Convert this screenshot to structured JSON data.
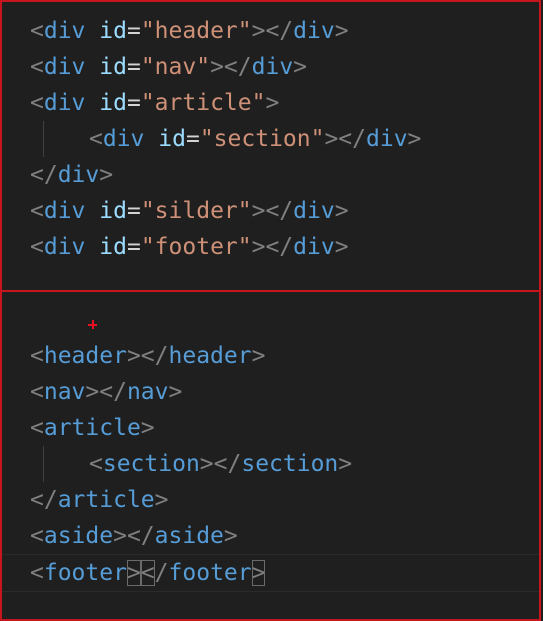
{
  "top_code": {
    "lines": [
      {
        "indent": 0,
        "tokens": [
          [
            "<",
            "tag-delim"
          ],
          [
            "div",
            "tag-name"
          ],
          [
            " ",
            ""
          ],
          [
            "id",
            "attr-name"
          ],
          [
            "=",
            "attr-eq"
          ],
          [
            "\"header\"",
            "attr-val"
          ],
          [
            "></",
            "tag-delim"
          ],
          [
            "div",
            "tag-name"
          ],
          [
            ">",
            "tag-delim"
          ]
        ]
      },
      {
        "indent": 0,
        "tokens": [
          [
            "<",
            "tag-delim"
          ],
          [
            "div",
            "tag-name"
          ],
          [
            " ",
            ""
          ],
          [
            "id",
            "attr-name"
          ],
          [
            "=",
            "attr-eq"
          ],
          [
            "\"nav\"",
            "attr-val"
          ],
          [
            "></",
            "tag-delim"
          ],
          [
            "div",
            "tag-name"
          ],
          [
            ">",
            "tag-delim"
          ]
        ]
      },
      {
        "indent": 0,
        "tokens": [
          [
            "<",
            "tag-delim"
          ],
          [
            "div",
            "tag-name"
          ],
          [
            " ",
            ""
          ],
          [
            "id",
            "attr-name"
          ],
          [
            "=",
            "attr-eq"
          ],
          [
            "\"article\"",
            "attr-val"
          ],
          [
            ">",
            "tag-delim"
          ]
        ]
      },
      {
        "indent": 1,
        "tokens": [
          [
            "<",
            "tag-delim"
          ],
          [
            "div",
            "tag-name"
          ],
          [
            " ",
            ""
          ],
          [
            "id",
            "attr-name"
          ],
          [
            "=",
            "attr-eq"
          ],
          [
            "\"section\"",
            "attr-val"
          ],
          [
            "></",
            "tag-delim"
          ],
          [
            "div",
            "tag-name"
          ],
          [
            ">",
            "tag-delim"
          ]
        ]
      },
      {
        "indent": 0,
        "tokens": [
          [
            "</",
            "tag-delim"
          ],
          [
            "div",
            "tag-name"
          ],
          [
            ">",
            "tag-delim"
          ]
        ]
      },
      {
        "indent": 0,
        "tokens": [
          [
            "<",
            "tag-delim"
          ],
          [
            "div",
            "tag-name"
          ],
          [
            " ",
            ""
          ],
          [
            "id",
            "attr-name"
          ],
          [
            "=",
            "attr-eq"
          ],
          [
            "\"silder\"",
            "attr-val"
          ],
          [
            "></",
            "tag-delim"
          ],
          [
            "div",
            "tag-name"
          ],
          [
            ">",
            "tag-delim"
          ]
        ]
      },
      {
        "indent": 0,
        "tokens": [
          [
            "<",
            "tag-delim"
          ],
          [
            "div",
            "tag-name"
          ],
          [
            " ",
            ""
          ],
          [
            "id",
            "attr-name"
          ],
          [
            "=",
            "attr-eq"
          ],
          [
            "\"footer\"",
            "attr-val"
          ],
          [
            "></",
            "tag-delim"
          ],
          [
            "div",
            "tag-name"
          ],
          [
            ">",
            "tag-delim"
          ]
        ]
      }
    ]
  },
  "bottom_code": {
    "lines": [
      {
        "indent": 0,
        "tokens": [
          [
            "<",
            "tag-delim"
          ],
          [
            "header",
            "tag-name"
          ],
          [
            "></",
            "tag-delim"
          ],
          [
            "header",
            "tag-name"
          ],
          [
            ">",
            "tag-delim"
          ]
        ]
      },
      {
        "indent": 0,
        "tokens": [
          [
            "<",
            "tag-delim"
          ],
          [
            "nav",
            "tag-name"
          ],
          [
            "></",
            "tag-delim"
          ],
          [
            "nav",
            "tag-name"
          ],
          [
            ">",
            "tag-delim"
          ]
        ]
      },
      {
        "indent": 0,
        "tokens": [
          [
            "<",
            "tag-delim"
          ],
          [
            "article",
            "tag-name"
          ],
          [
            ">",
            "tag-delim"
          ]
        ]
      },
      {
        "indent": 1,
        "tokens": [
          [
            "<",
            "tag-delim"
          ],
          [
            "section",
            "tag-name"
          ],
          [
            "></",
            "tag-delim"
          ],
          [
            "section",
            "tag-name"
          ],
          [
            ">",
            "tag-delim"
          ]
        ]
      },
      {
        "indent": 0,
        "tokens": [
          [
            "</",
            "tag-delim"
          ],
          [
            "article",
            "tag-name"
          ],
          [
            ">",
            "tag-delim"
          ]
        ]
      },
      {
        "indent": 0,
        "tokens": [
          [
            "<",
            "tag-delim"
          ],
          [
            "aside",
            "tag-name"
          ],
          [
            "></",
            "tag-delim"
          ],
          [
            "aside",
            "tag-name"
          ],
          [
            ">",
            "tag-delim"
          ]
        ]
      },
      {
        "indent": 0,
        "active": true,
        "tokens": [
          [
            "<",
            "tag-delim"
          ],
          [
            "footer",
            "tag-name"
          ],
          [
            ">",
            "tag-delim",
            "bracket-match"
          ],
          [
            "<",
            "tag-delim",
            "bracket-match"
          ],
          [
            "/",
            "tag-delim"
          ],
          [
            "footer",
            "tag-name"
          ],
          [
            ">",
            "tag-delim",
            "bracket-match"
          ]
        ]
      }
    ]
  },
  "colors": {
    "panel_border": "#c4161c",
    "background": "#1f1f1f",
    "tag": "#569cd6",
    "attr_name": "#9cdcfe",
    "attr_value": "#ce9178",
    "delimiter": "#808080"
  }
}
